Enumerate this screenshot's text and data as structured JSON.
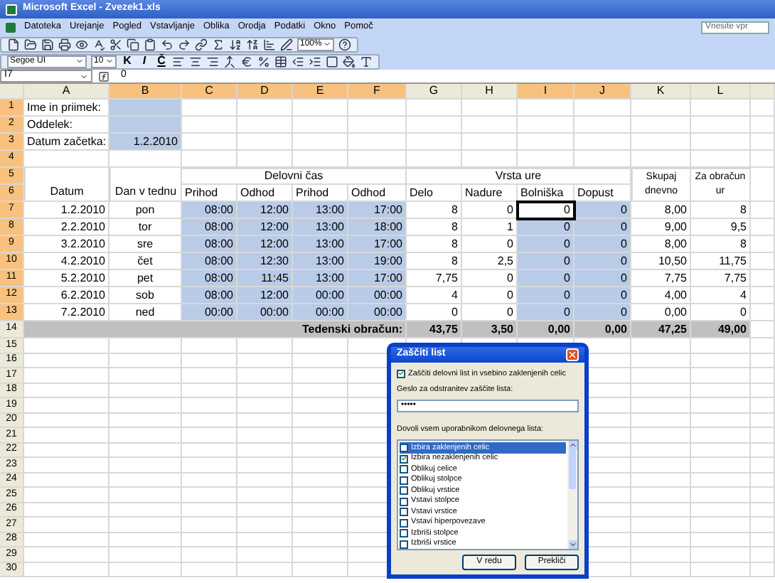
{
  "window": {
    "title": "Microsoft Excel - Zvezek1.xls"
  },
  "menu": [
    "Datoteka",
    "Urejanje",
    "Pogled",
    "Vstavljanje",
    "Oblika",
    "Orodja",
    "Podatki",
    "Okno",
    "Pomoč"
  ],
  "help_box": {
    "placeholder": "Vnesite vpr"
  },
  "toolbar": {
    "zoom": "100%",
    "font": "Segoe UI",
    "font_size": "10",
    "format_buttons": [
      "K",
      "I",
      "Č"
    ]
  },
  "formula_bar": {
    "name_box": "I7",
    "value": "0"
  },
  "columns": [
    {
      "label": "A",
      "selected": false
    },
    {
      "label": "B",
      "selected": true
    },
    {
      "label": "C",
      "selected": true
    },
    {
      "label": "D",
      "selected": true
    },
    {
      "label": "E",
      "selected": true
    },
    {
      "label": "F",
      "selected": true
    },
    {
      "label": "G",
      "selected": false
    },
    {
      "label": "H",
      "selected": false
    },
    {
      "label": "I",
      "selected": true
    },
    {
      "label": "J",
      "selected": true
    },
    {
      "label": "K",
      "selected": false
    },
    {
      "label": "L",
      "selected": false
    }
  ],
  "rows": [
    {
      "label": "1",
      "selected": true
    },
    {
      "label": "2",
      "selected": true
    },
    {
      "label": "3",
      "selected": true
    },
    {
      "label": "4",
      "selected": true
    },
    {
      "label": "5",
      "selected": true
    },
    {
      "label": "6",
      "selected": true
    },
    {
      "label": "7",
      "selected": true
    },
    {
      "label": "8",
      "selected": true
    },
    {
      "label": "9",
      "selected": true
    },
    {
      "label": "10",
      "selected": true
    },
    {
      "label": "11",
      "selected": true
    },
    {
      "label": "12",
      "selected": true
    },
    {
      "label": "13",
      "selected": true
    },
    {
      "label": "14",
      "selected": false
    },
    {
      "label": "15",
      "selected": false
    },
    {
      "label": "16",
      "selected": false
    },
    {
      "label": "17",
      "selected": false
    },
    {
      "label": "18",
      "selected": false
    },
    {
      "label": "19",
      "selected": false
    },
    {
      "label": "20",
      "selected": false
    },
    {
      "label": "21",
      "selected": false
    },
    {
      "label": "22",
      "selected": false
    },
    {
      "label": "23",
      "selected": false
    },
    {
      "label": "24",
      "selected": false
    },
    {
      "label": "25",
      "selected": false
    },
    {
      "label": "26",
      "selected": false
    },
    {
      "label": "27",
      "selected": false
    },
    {
      "label": "28",
      "selected": false
    },
    {
      "label": "29",
      "selected": false
    },
    {
      "label": "30",
      "selected": false
    }
  ],
  "info": [
    {
      "label": "Ime in priimek:"
    },
    {
      "label": "Oddelek:"
    },
    {
      "label": "Datum začetka:",
      "value": "1.2.2010"
    }
  ],
  "table": {
    "date_header": "Datum",
    "day_header": "Dan v tednu",
    "time_group": "Delovni čas",
    "time_headers": [
      "Prihod",
      "Odhod",
      "Prihod",
      "Odhod"
    ],
    "hours_group": "Vrsta ure",
    "hours_headers": [
      "Delo",
      "Nadure",
      "Bolniška",
      "Dopust"
    ],
    "total_header": "Skupaj dnevno",
    "billing_header": "Za obračun ur",
    "rows": [
      {
        "date": "1.2.2010",
        "day": "pon",
        "times": [
          "08:00",
          "12:00",
          "13:00",
          "17:00"
        ],
        "hours": [
          {
            "v": "8",
            "active": false
          },
          {
            "v": "0",
            "active": false
          },
          {
            "v": "0",
            "active": true
          },
          {
            "v": "0",
            "active": false
          }
        ],
        "total": "8,00",
        "billing": "8"
      },
      {
        "date": "2.2.2010",
        "day": "tor",
        "times": [
          "08:00",
          "12:00",
          "13:00",
          "18:00"
        ],
        "hours": [
          {
            "v": "8",
            "active": false
          },
          {
            "v": "1",
            "active": false
          },
          {
            "v": "0",
            "active": false
          },
          {
            "v": "0",
            "active": false
          }
        ],
        "total": "9,00",
        "billing": "9,5"
      },
      {
        "date": "3.2.2010",
        "day": "sre",
        "times": [
          "08:00",
          "12:00",
          "13:00",
          "17:00"
        ],
        "hours": [
          {
            "v": "8",
            "active": false
          },
          {
            "v": "0",
            "active": false
          },
          {
            "v": "0",
            "active": false
          },
          {
            "v": "0",
            "active": false
          }
        ],
        "total": "8,00",
        "billing": "8"
      },
      {
        "date": "4.2.2010",
        "day": "čet",
        "times": [
          "08:00",
          "12:30",
          "13:00",
          "19:00"
        ],
        "hours": [
          {
            "v": "8",
            "active": false
          },
          {
            "v": "2,5",
            "active": false
          },
          {
            "v": "0",
            "active": false
          },
          {
            "v": "0",
            "active": false
          }
        ],
        "total": "10,50",
        "billing": "11,75"
      },
      {
        "date": "5.2.2010",
        "day": "pet",
        "times": [
          "08:00",
          "11:45",
          "13:00",
          "17:00"
        ],
        "hours": [
          {
            "v": "7,75",
            "active": false
          },
          {
            "v": "0",
            "active": false
          },
          {
            "v": "0",
            "active": false
          },
          {
            "v": "0",
            "active": false
          }
        ],
        "total": "7,75",
        "billing": "7,75"
      },
      {
        "date": "6.2.2010",
        "day": "sob",
        "times": [
          "08:00",
          "12:00",
          "00:00",
          "00:00"
        ],
        "hours": [
          {
            "v": "4",
            "active": false
          },
          {
            "v": "0",
            "active": false
          },
          {
            "v": "0",
            "active": false
          },
          {
            "v": "0",
            "active": false
          }
        ],
        "total": "4,00",
        "billing": "4"
      },
      {
        "date": "7.2.2010",
        "day": "ned",
        "times": [
          "00:00",
          "00:00",
          "00:00",
          "00:00"
        ],
        "hours": [
          {
            "v": "0",
            "active": false
          },
          {
            "v": "0",
            "active": false
          },
          {
            "v": "0",
            "active": false
          },
          {
            "v": "0",
            "active": false
          }
        ],
        "total": "0,00",
        "billing": "0"
      }
    ],
    "summary": {
      "label": "Tedenski obračun:",
      "values": [
        "43,75",
        "3,50",
        "0,00",
        "0,00",
        "47,25",
        "49,00"
      ]
    }
  },
  "dialog": {
    "title": "Zaščiti list",
    "protect": {
      "label": "Zaščiti delovni list in vsebino zaklenjenih celic",
      "checked": true
    },
    "password_label": "Geslo za odstranitev zaščite lista:",
    "password": "•••••",
    "permissions_label": "Dovoli vsem uporabnikom delovnega lista:",
    "permissions": [
      {
        "label": "Izbira zaklenjenih celic",
        "checked": false,
        "selected": true
      },
      {
        "label": "Izbira nezaklenjenih celic",
        "checked": true,
        "selected": false
      },
      {
        "label": "Oblikuj celice",
        "checked": false,
        "selected": false
      },
      {
        "label": "Oblikuj stolpce",
        "checked": false,
        "selected": false
      },
      {
        "label": "Oblikuj vrstice",
        "checked": false,
        "selected": false
      },
      {
        "label": "Vstavi stolpce",
        "checked": false,
        "selected": false
      },
      {
        "label": "Vstavi vrstice",
        "checked": false,
        "selected": false
      },
      {
        "label": "Vstavi hiperpovezave",
        "checked": false,
        "selected": false
      },
      {
        "label": "Izbriši stolpce",
        "checked": false,
        "selected": false
      },
      {
        "label": "Izbriši vrstice",
        "checked": false,
        "selected": false
      }
    ],
    "buttons": [
      "V redu",
      "Prekliči"
    ]
  }
}
